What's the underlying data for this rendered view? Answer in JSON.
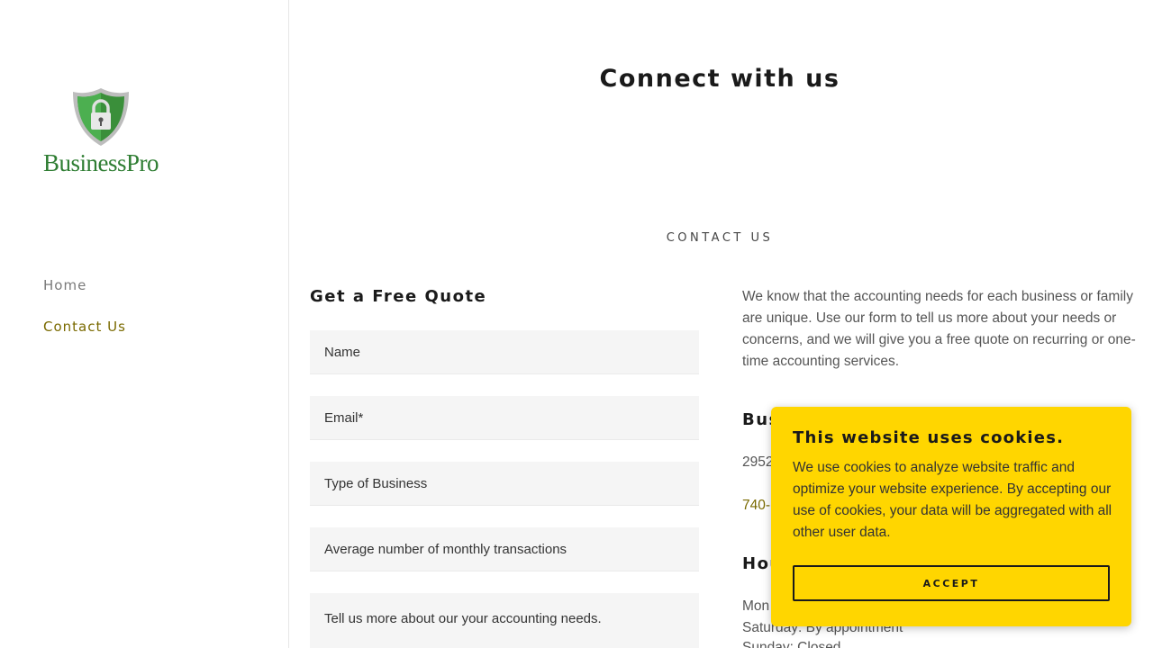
{
  "brand": {
    "name": "BusinessPro",
    "logo_icon": "padlock-shield-icon",
    "colors": {
      "green": "#2e7d32",
      "shield_silver": "#c8c8c8",
      "accent": "#7a6a00"
    }
  },
  "nav": {
    "items": [
      {
        "label": "Home",
        "active": false
      },
      {
        "label": "Contact Us",
        "active": true
      }
    ]
  },
  "main": {
    "title": "Connect with us",
    "section_label": "CONTACT US",
    "form": {
      "title": "Get a Free Quote",
      "fields": [
        {
          "placeholder": "Name"
        },
        {
          "placeholder": "Email*"
        },
        {
          "placeholder": "Type of Business"
        },
        {
          "placeholder": "Average number of monthly transactions"
        },
        {
          "placeholder": "Tell us more about our your accounting needs."
        }
      ]
    },
    "intro": "We know that the accounting needs for each business or family are unique. Use our form to tell us more about your needs or concerns, and we will give you a free quote on recurring or one-time accounting services.",
    "info": {
      "business_heading": "Bus",
      "address": "2952",
      "phone": "740-",
      "hours_heading": "Hou",
      "hours_line1": "Mon",
      "hours_line2": "Saturday: By appointment",
      "hours_line3": "Sunday: Closed"
    }
  },
  "cookie_banner": {
    "title": "This website uses cookies.",
    "text": "We use cookies to analyze website traffic and optimize your website experience. By accepting our use of cookies, your data will be aggregated with all other user data.",
    "accept_label": "ACCEPT",
    "background": "#ffd600"
  }
}
